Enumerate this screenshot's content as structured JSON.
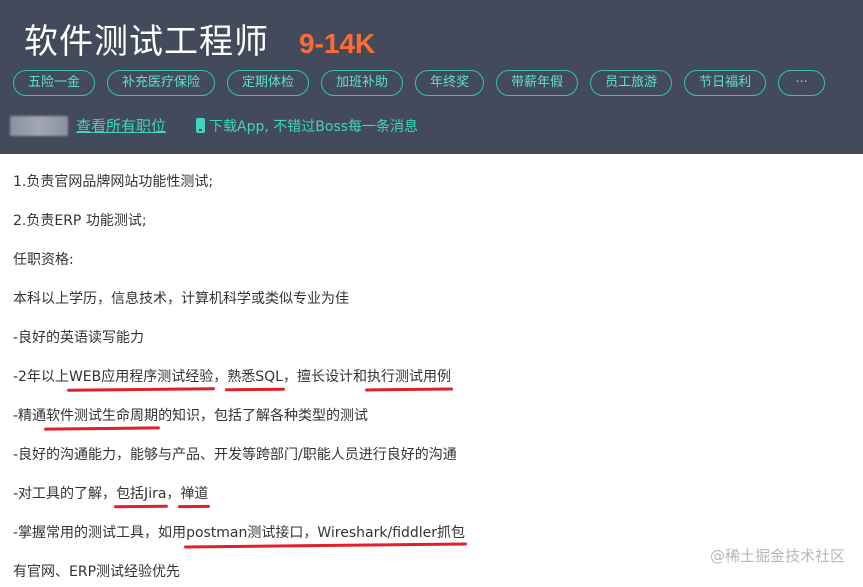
{
  "header": {
    "title": "软件测试工程师",
    "salary": "9-14K",
    "tags": [
      "五险一金",
      "补充医疗保险",
      "定期体检",
      "加班补助",
      "年终奖",
      "带薪年假",
      "员工旅游",
      "节日福利"
    ],
    "more_label": "···",
    "view_all": "查看所有职位",
    "download_message": "下载App, 不错过Boss每一条消息"
  },
  "description": {
    "line1": "1.负责官网品牌网站功能性测试;",
    "line2": "2.负责ERP 功能测试;",
    "line3": "任职资格:",
    "line4": "本科以上学历，信息技术，计算机科学或类似专业为佳",
    "line5": "-良好的英语读写能力",
    "line6": {
      "a": "-2年以上",
      "b": "WEB应用程序测试经验",
      "c": "，",
      "d": "熟悉SQL",
      "e": "，擅长设计和",
      "f": "执行测试用例"
    },
    "line7": {
      "a": "-精通",
      "b": "软件测试生命周期",
      "c": "的知识，包括了解各种类型的测试"
    },
    "line8": "-良好的沟通能力，能够与产品、开发等跨部门/职能人员进行良好的沟通",
    "line9": {
      "a": "-对工具的了解，",
      "b": "包括Jira",
      "c": "，",
      "d": "禅道"
    },
    "line10": {
      "a": "-掌握常用的测试工具，如用",
      "b": "postman测试接口，Wireshark/fiddler抓包"
    },
    "line11": "有官网、ERP测试经验优先"
  },
  "watermark": "@稀土掘金技术社区",
  "colors": {
    "header_bg": "#434a5c",
    "salary": "#ff6b35",
    "accent": "#3ed4bf",
    "underline": "#e0202a"
  }
}
